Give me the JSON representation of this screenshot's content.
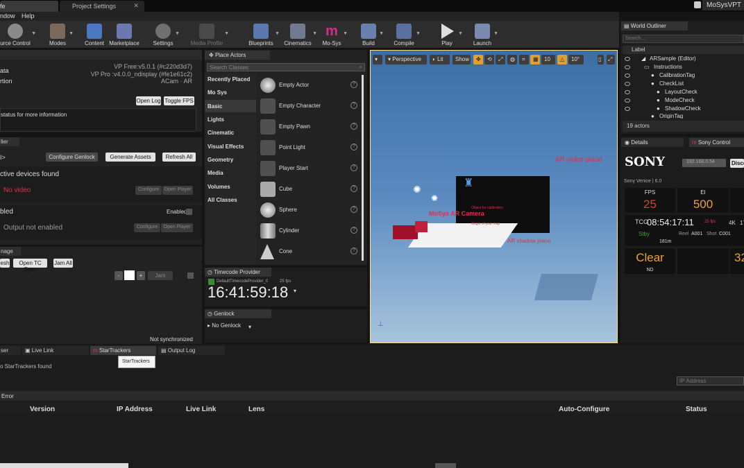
{
  "tabs": {
    "main": "fe",
    "project_settings": "Project Settings",
    "app_title": "MoSysVPT"
  },
  "menu": {
    "window": "ndow",
    "help": "Help"
  },
  "toolbar": {
    "source_control": "urce Control",
    "modes": "Modes",
    "content": "Content",
    "marketplace": "Marketplace",
    "settings": "Settings",
    "media_profile": "Media Profile",
    "blueprints": "Blueprints",
    "cinematics": "Cinematics",
    "mosys": "Mo-Sys",
    "build": "Build",
    "compile": "Compile",
    "play": "Play",
    "launch": "Launch"
  },
  "left": {
    "row1": "ata",
    "row2": "rtion",
    "vp_free": "VP Free:v5.0.1 (#c220d3d7)",
    "vp_pro": "VP Pro :v4.0.0_ndisplay (#fe1e61c2)",
    "acam": "ACam  · AR",
    "open_log": "Open Log",
    "toggle_fps": "Toggle FPS",
    "status_text": " status for more information",
    "section2_tab": "ller",
    "genlock_arrow": "I>",
    "configure_genlock": "Configure Genlock",
    "generate_assets": "Generate Assets",
    "refresh_all": "Refresh All",
    "devices_found": "ctive devices found",
    "no_video": "No video",
    "configure1": "Configure",
    "open_player1": "Open Player",
    "enabled_label": "bled",
    "enabled_chk": "Enabled",
    "output_not_enabled": "Output not enabled",
    "configure2": "Configure",
    "open_player2": "Open Player",
    "timecode_tab": "nage",
    "btn_esh": "esh",
    "open_tc_sync": "Open TC Sync",
    "jam_all": "Jam All",
    "minus": "-",
    "plus": "+",
    "jam": "Jam",
    "not_synchronized": "Not synchronized"
  },
  "place_actors": {
    "title": "Place Actors",
    "search_placeholder": "Search Classes",
    "categories": [
      "Recently Placed",
      "Mo Sys",
      "Basic",
      "Lights",
      "Cinematic",
      "Visual Effects",
      "Geometry",
      "Media",
      "Volumes",
      "All Classes"
    ],
    "actors": [
      "Empty Actor",
      "Empty Character",
      "Empty Pawn",
      "Point Light",
      "Player Start",
      "Cube",
      "Sphere",
      "Cylinder",
      "Cone"
    ]
  },
  "timecode": {
    "title": "Timecode Provider",
    "provider": "DefaultTimecodeProvider_0",
    "fps": "25 fps",
    "time": "16:41:59:18"
  },
  "genlock": {
    "title": "Genlock",
    "value": "No Genlock"
  },
  "viewport": {
    "perspective": "Perspective",
    "lit": "Lit",
    "show": "Show",
    "grid": "10",
    "angle": "10°",
    "ar_video_plane": "AR video plane",
    "mosys_camera": "MoSys AR Camera",
    "ar_shadow_plane": "AR shadow plane",
    "object_for_calibration": "Object for calibration",
    "origin": "Origin of your map"
  },
  "outliner": {
    "title": "World Outliner",
    "search_placeholder": "Search...",
    "label_col": "Label",
    "items": [
      "ARSample (Editor)",
      "Instructions",
      "CalibrationTag",
      "CheckList",
      "LayoutCheck",
      "ModeCheck",
      "ShadowCheck",
      "OriginTag"
    ],
    "count": "19 actors"
  },
  "details": {
    "tab": "Details",
    "sony_tab": "Sony Control",
    "brand": "SONY",
    "ip": "192.168.0.54",
    "disconnect": "Disco",
    "model": "Sony Venice | 6.0",
    "fps_label": "FPS",
    "fps": "25",
    "ei_label": "EI",
    "ei": "500",
    "tc_label": "TCG",
    "tc": "08:54:17:11",
    "tc_fps": "25 fps",
    "res": "4K",
    "res2": "17",
    "stby": "Stby",
    "reel_label": "Reel",
    "reel": "A001",
    "shot_label": "Shot",
    "shot": "C001",
    "len": "181m",
    "nd": "Clear",
    "nd_label": "ND",
    "right_val": "32"
  },
  "bottom": {
    "tab_user": "ser",
    "tab_livelink": "Live Link",
    "tab_startrackers": "StarTrackers",
    "tab_outputlog": "Output Log",
    "tooltip": "StarTrackers",
    "no_startrackers": "o StarTrackers found",
    "ip_placeholder": "IP Address",
    "error": "Error",
    "columns": [
      "Version",
      "IP Address",
      "Live Link",
      "Lens",
      "Auto-Configure",
      "Status"
    ]
  },
  "colors": {
    "accent_red": "#e0304a",
    "mosys_pink": "#d0308a",
    "sony_red": "#e23b3b",
    "orange": "#f0a030"
  }
}
